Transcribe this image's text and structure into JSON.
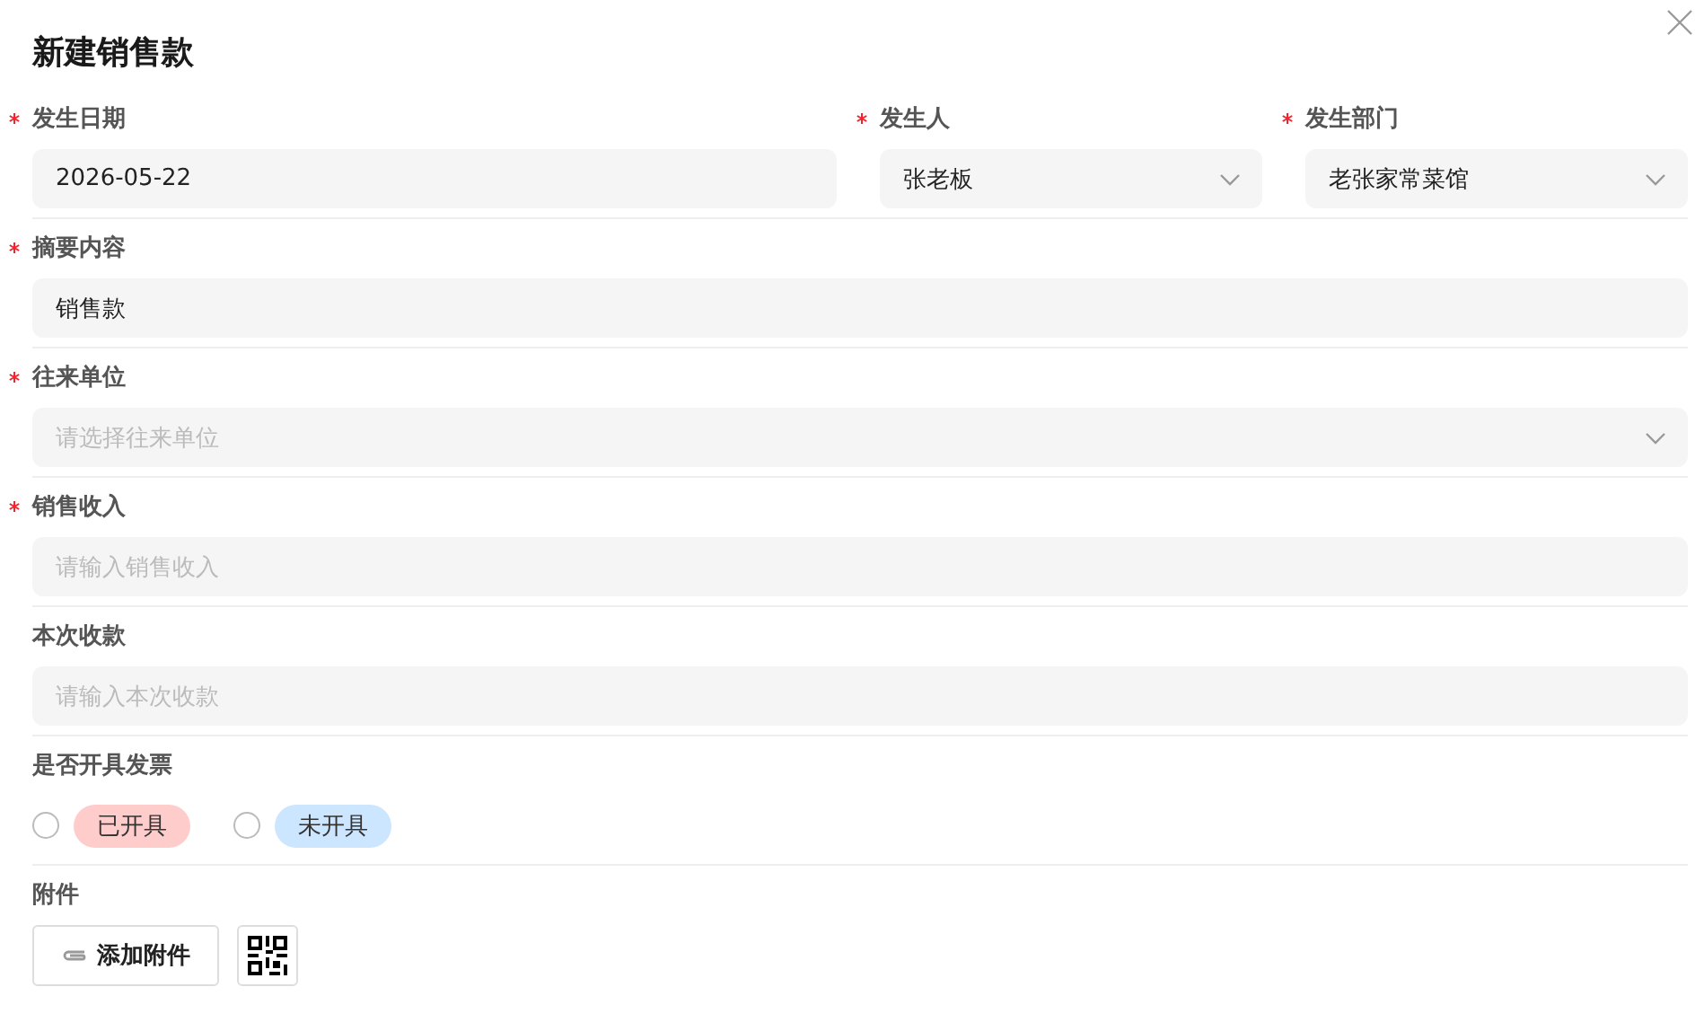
{
  "dialog": {
    "title": "新建销售款"
  },
  "rows": [
    {
      "fields": [
        {
          "label": "发生日期",
          "required": true,
          "kind": "date",
          "value": "2026-05-22"
        },
        {
          "label": "发生人",
          "required": true,
          "kind": "select",
          "value": "张老板"
        },
        {
          "label": "发生部门",
          "required": true,
          "kind": "select",
          "value": "老张家常菜馆"
        }
      ]
    },
    {
      "fields": [
        {
          "label": "摘要内容",
          "required": true,
          "kind": "text",
          "value": "销售款"
        }
      ]
    },
    {
      "fields": [
        {
          "label": "往来单位",
          "required": true,
          "kind": "select",
          "placeholder": "请选择往来单位"
        }
      ]
    },
    {
      "fields": [
        {
          "label": "销售收入",
          "required": true,
          "kind": "text",
          "placeholder": "请输入销售收入"
        }
      ]
    },
    {
      "fields": [
        {
          "label": "本次收款",
          "required": false,
          "kind": "text",
          "placeholder": "请输入本次收款"
        }
      ]
    },
    {
      "fields": [
        {
          "label": "是否开具发票",
          "required": false,
          "kind": "radio",
          "options": [
            {
              "label": "已开具",
              "selected": false,
              "color": "#ffcccc"
            },
            {
              "label": "未开具",
              "selected": false,
              "color": "#cce6ff"
            }
          ]
        }
      ]
    },
    {
      "fields": [
        {
          "label": "附件",
          "required": false,
          "kind": "attachment",
          "button": "添加附件"
        }
      ]
    }
  ]
}
